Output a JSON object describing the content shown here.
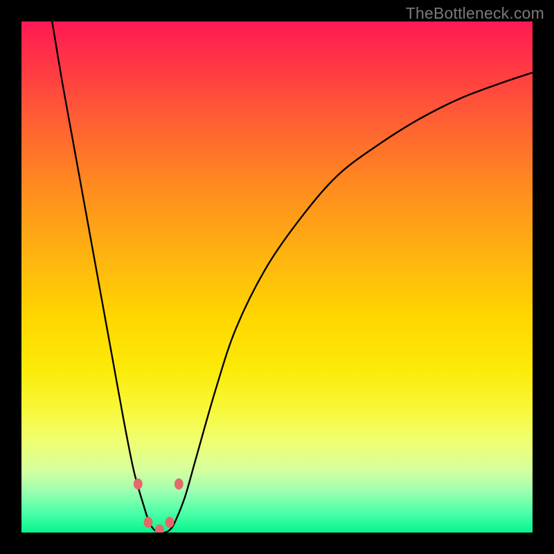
{
  "watermark": "TheBottleneck.com",
  "chart_data": {
    "type": "line",
    "title": "",
    "xlabel": "",
    "ylabel": "",
    "xlim": [
      0,
      100
    ],
    "ylim": [
      0,
      100
    ],
    "gradient_stops": [
      {
        "pos": 0,
        "color": "#ff1a54"
      },
      {
        "pos": 8,
        "color": "#ff3545"
      },
      {
        "pos": 18,
        "color": "#ff5a36"
      },
      {
        "pos": 32,
        "color": "#ff8a1f"
      },
      {
        "pos": 46,
        "color": "#ffb410"
      },
      {
        "pos": 58,
        "color": "#ffd700"
      },
      {
        "pos": 68,
        "color": "#fcea08"
      },
      {
        "pos": 76,
        "color": "#f8f83a"
      },
      {
        "pos": 82,
        "color": "#f0ff70"
      },
      {
        "pos": 88,
        "color": "#d4ffa0"
      },
      {
        "pos": 92,
        "color": "#9bffb0"
      },
      {
        "pos": 96,
        "color": "#4dffa8"
      },
      {
        "pos": 100,
        "color": "#06f58d"
      }
    ],
    "series": [
      {
        "name": "bottleneck-curve",
        "x": [
          6,
          8,
          10,
          12,
          14,
          16,
          18,
          20,
          22,
          24,
          25,
          26,
          27,
          28,
          29,
          30,
          32,
          34,
          38,
          42,
          48,
          55,
          62,
          70,
          78,
          86,
          94,
          100
        ],
        "y": [
          100,
          88,
          77,
          66,
          55,
          44,
          33,
          22,
          12,
          5,
          2,
          0.5,
          0,
          0,
          0.5,
          2,
          7,
          14,
          28,
          40,
          52,
          62,
          70,
          76,
          81,
          85,
          88,
          90
        ]
      }
    ],
    "markers": {
      "color": "#e36a6a",
      "radius_px": 8,
      "points": [
        {
          "x": 22.8,
          "y": 9.5
        },
        {
          "x": 24.8,
          "y": 2.0
        },
        {
          "x": 27.0,
          "y": 0.5
        },
        {
          "x": 29.0,
          "y": 2.0
        },
        {
          "x": 30.8,
          "y": 9.5
        }
      ]
    },
    "annotations": []
  }
}
